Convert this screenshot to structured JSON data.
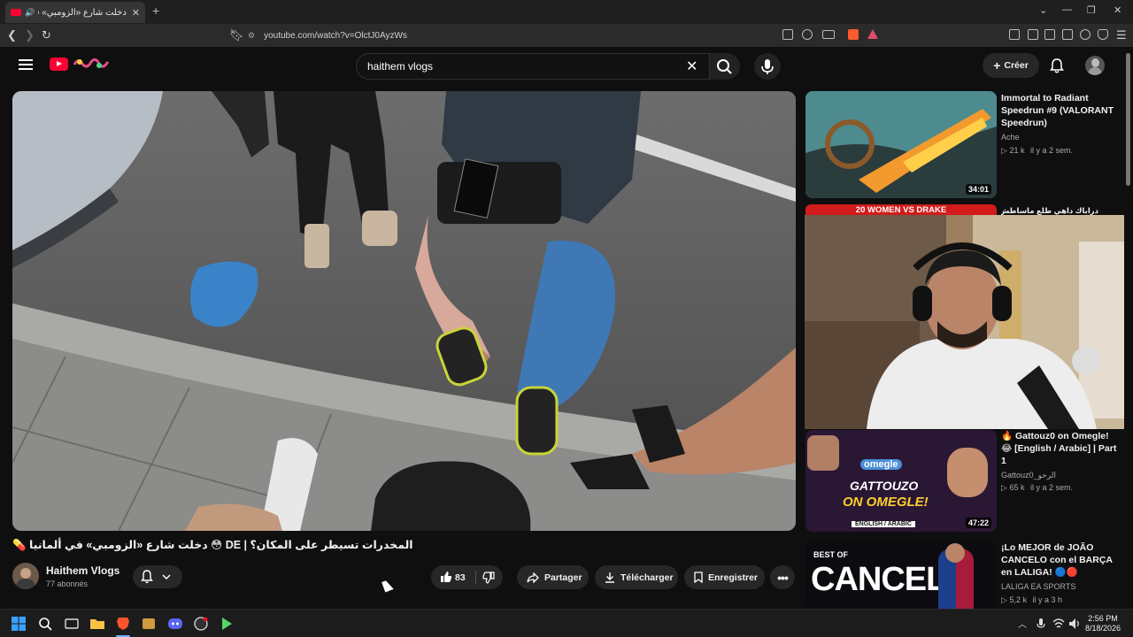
{
  "browser": {
    "tab_title": "دخلت شارع «الزومبي» في ألمانيا",
    "url": "youtube.com/watch?v=OlctJ0AyzWs"
  },
  "header": {
    "search_value": "haithem vlogs",
    "create_label": "Créer"
  },
  "video": {
    "title": "المخدرات تسيطر على المكان؟ | DE 😳 دخلت شارع «الزومبي» في ألمانيا 💊",
    "channel_name": "Haithem Vlogs",
    "subscribers": "77 abonnés",
    "likes": "83",
    "share_label": "Partager",
    "download_label": "Télécharger",
    "save_label": "Enregistrer"
  },
  "sidebar": {
    "items": [
      {
        "title": "Immortal to Radiant Speedrun #9 (VALORANT Speedrun)",
        "channel": "Ache",
        "views": "21 k",
        "age": "il y a 2 sem.",
        "duration": "34:01"
      },
      {
        "title": "دراباك داهي طلع ماساطش || 👀",
        "thumb_text": "20 WOMEN VS DRAKE"
      },
      {
        "title": "🔥 Gattouz0 on Omegle! 😂 [English / Arabic] | Part 1",
        "channel": "Gattouz0_الرحو",
        "views": "65 k",
        "age": "il y a 2 sem.",
        "duration": "47:22",
        "thumb_text_1": "omegle",
        "thumb_text_2": "GATTOUZO",
        "thumb_text_3": "ON OMEGLE!",
        "thumb_text_4": "ENGLISH / ARABIC"
      },
      {
        "title": "¡Lo MEJOR de JOÃO CANCELO con el BARÇA en LALIGA! 🔵🔴",
        "channel": "LALIGA EA SPORTS",
        "views": "5,2 k",
        "age": "il y a 3 h",
        "thumb_text_1": "BEST OF",
        "thumb_text_2": "CANCEL"
      }
    ]
  },
  "taskbar": {
    "time": "2:56 PM",
    "date": "8/18/2026"
  },
  "colors": {
    "yt_red": "#ff0033",
    "bg": "#0f0f0f",
    "pill": "#272727"
  }
}
